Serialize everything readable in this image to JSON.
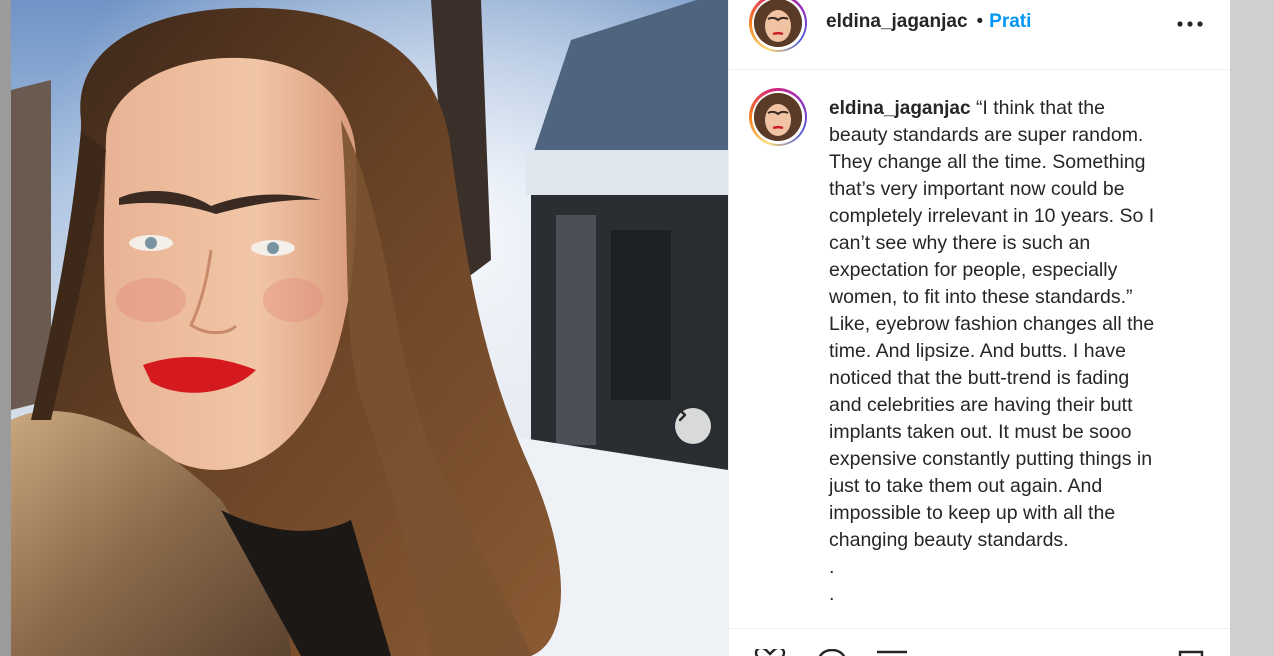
{
  "post": {
    "author": "eldina_jaganjac",
    "separator": "•",
    "follow_label": "Prati",
    "caption_lines": [
      "“I think that the",
      "beauty standards are super random.",
      "They change all the time. Something",
      "that’s very important now could be",
      "completely irrelevant in 10 years. So I",
      "can’t see why there is such an",
      "expectation for people, especially",
      "women, to fit into these standards.”",
      "Like, eyebrow fashion changes all the",
      "time. And lipsize. And butts. I have",
      "noticed that the butt-trend is fading",
      "and celebrities are having their butt",
      "implants taken out. It must be sooo",
      "expensive constantly putting things in",
      "just to take them out again. And",
      "impossible to keep up with all the",
      "changing beauty standards.",
      ".",
      "."
    ]
  },
  "icons": {
    "more": "more-options-icon",
    "next": "chevron-right-icon",
    "like": "heart-icon",
    "comment": "comment-icon",
    "share": "share-icon",
    "save": "bookmark-icon"
  },
  "colors": {
    "follow": "#0095f6",
    "text": "#262626",
    "lipstick": "#d41a1e"
  }
}
